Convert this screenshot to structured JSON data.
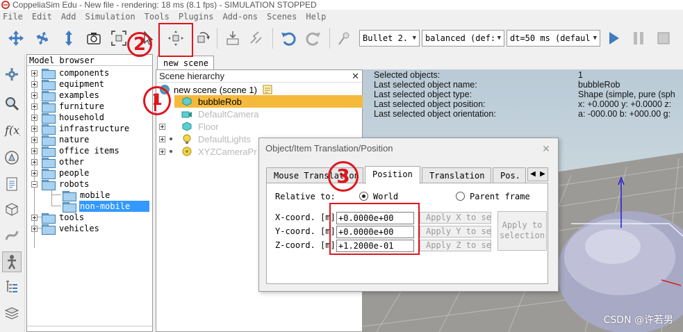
{
  "window": {
    "title": "CoppeliaSim Edu - New file - rendering: 18 ms (8.1 fps) - SIMULATION STOPPED"
  },
  "menu": [
    "File",
    "Edit",
    "Add",
    "Simulation",
    "Tools",
    "Plugins",
    "Add-ons",
    "Scenes",
    "Help"
  ],
  "toolbar": {
    "engine": "Bullet 2.",
    "accuracy": "balanced (def:",
    "timestep": "dt=50 ms (defaul"
  },
  "model_browser": {
    "header": "Model browser",
    "items": [
      "components",
      "equipment",
      "examples",
      "furniture",
      "household",
      "infrastructure",
      "nature",
      "office items",
      "other",
      "people",
      "robots",
      "mobile",
      "non-mobile",
      "tools",
      "vehicles"
    ]
  },
  "scene": {
    "tab": "new scene",
    "hierarchy_title": "Scene hierarchy",
    "close_glyph": "✕",
    "root": "new scene (scene 1)",
    "objects": [
      "bubbleRob",
      "DefaultCamera",
      "Floor",
      "DefaultLights",
      "XYZCameraPr"
    ]
  },
  "info": {
    "labels": [
      "Selected objects:",
      "Last selected object name:",
      "Last selected object type:",
      "Last selected object position:",
      "Last selected object orientation:"
    ],
    "values": [
      "1",
      "bubbleRob",
      "Shape (simple, pure (sph",
      "x: +0.0000   y: +0.0000   z:",
      "a: -000.00   b: +000.00   g:"
    ]
  },
  "dialog": {
    "title": "Object/Item Translation/Position",
    "close_glyph": "✕",
    "tabs": [
      "Mouse Translation",
      "Position",
      "Translation",
      "Pos. "
    ],
    "relative_to_label": "Relative to:",
    "world": "World",
    "parent_frame": "Parent frame",
    "x_label": "X-coord. [m]",
    "y_label": "Y-coord. [m]",
    "z_label": "Z-coord. [m]",
    "x_value": "+0.0000e+00",
    "y_value": "+0.0000e+00",
    "z_value": "+1.2000e-01",
    "apply_x": "Apply X to sel.",
    "apply_y": "Apply Y to sel.",
    "apply_z": "Apply Z to sel.",
    "apply_selection": [
      "Apply to",
      "selection"
    ]
  },
  "annotations": {
    "one": "1",
    "two": "2",
    "three": "3"
  },
  "watermark": "CSDN @许若男",
  "colors": {
    "annotation_red": "#e0141e",
    "selection_blue": "#3399ff",
    "hierarchy_selected": "#f5b93c"
  }
}
